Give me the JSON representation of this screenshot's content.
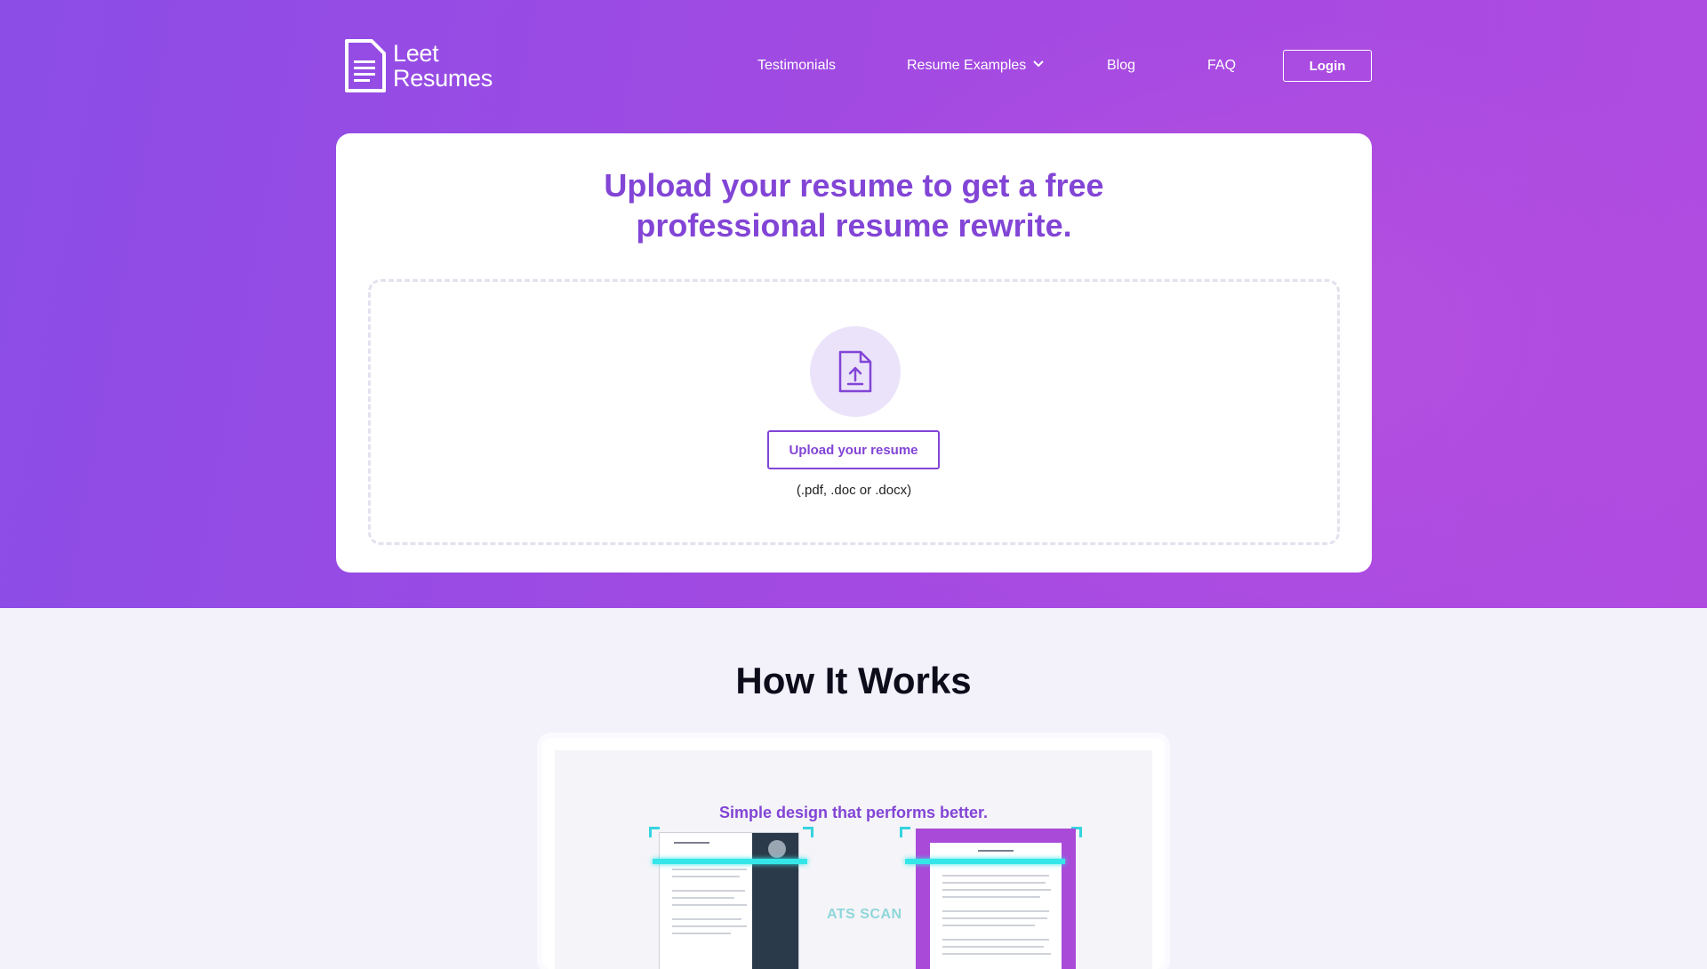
{
  "brand": {
    "line1": "Leet",
    "line2": "Resumes",
    "logo_icon": "document-icon"
  },
  "nav": {
    "testimonials": "Testimonials",
    "resume_examples": "Resume Examples",
    "blog": "Blog",
    "faq": "FAQ",
    "login": "Login"
  },
  "hero": {
    "headline_line1": "Upload your resume to get a free",
    "headline_line2": "professional resume rewrite.",
    "upload_icon": "file-upload-icon",
    "upload_button": "Upload your resume",
    "formats": "(.pdf, .doc or .docx)"
  },
  "how_it_works": {
    "title": "How It Works",
    "video_caption": "Simple design that performs better.",
    "scan_label": "ATS SCAN"
  },
  "colors": {
    "primary": "#8245d6",
    "hero_start": "#8b4de6",
    "hero_end": "#b04be0",
    "scan": "#35e6e9"
  }
}
